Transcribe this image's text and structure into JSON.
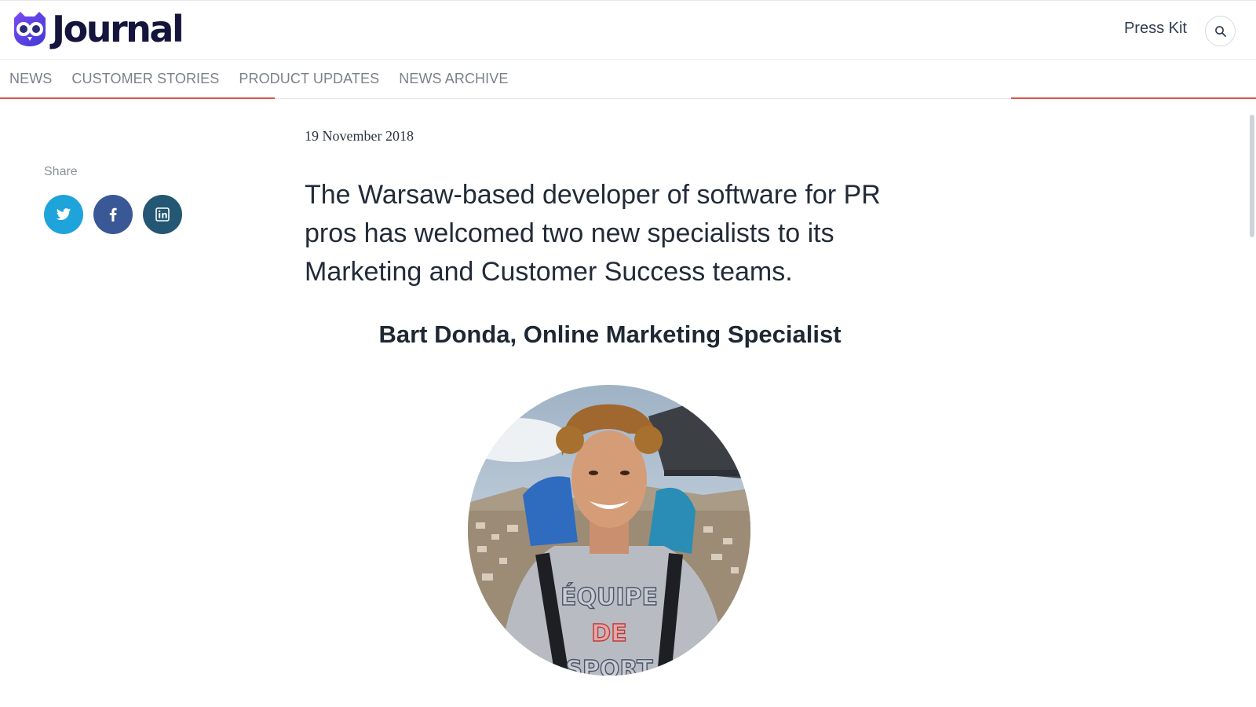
{
  "brand": {
    "name": "Journal",
    "accent": "#5b44e0",
    "text_color": "#14143c"
  },
  "header": {
    "press_kit_label": "Press Kit",
    "search_icon": "search-icon"
  },
  "nav": {
    "items": [
      {
        "label": "NEWS"
      },
      {
        "label": "CUSTOMER STORIES"
      },
      {
        "label": "PRODUCT UPDATES"
      },
      {
        "label": "NEWS ARCHIVE"
      }
    ],
    "accent_color": "#e0574c"
  },
  "share": {
    "label": "Share",
    "buttons": [
      {
        "network": "twitter",
        "icon": "twitter-icon",
        "color": "#1ea4db"
      },
      {
        "network": "facebook",
        "icon": "facebook-icon",
        "color": "#3a5796"
      },
      {
        "network": "linkedin",
        "icon": "linkedin-icon",
        "color": "#245773"
      }
    ]
  },
  "article": {
    "date": "19 November 2018",
    "lead": "The Warsaw-based developer of software for PR pros has welcomed two new specialists to its Marketing and Customer Success teams.",
    "subhead": "Bart Donda, Online Marketing Specialist",
    "photo": {
      "shirt_lines": [
        "ÉQUIPE",
        "DE",
        "SPORT"
      ]
    }
  }
}
